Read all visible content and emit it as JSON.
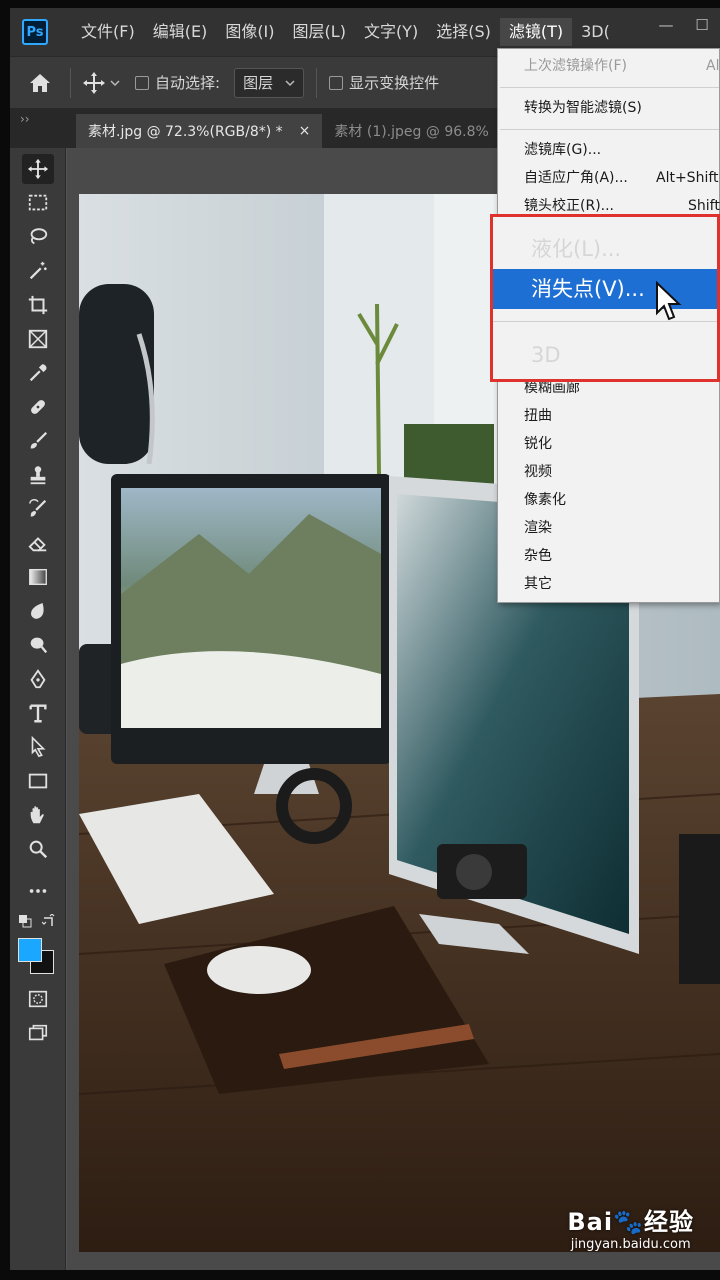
{
  "app": {
    "logo": "Ps"
  },
  "menubar": {
    "items": [
      "文件(F)",
      "编辑(E)",
      "图像(I)",
      "图层(L)",
      "文字(Y)",
      "选择(S)",
      "滤镜(T)",
      "3D("
    ],
    "active_index": 6
  },
  "window_controls": {
    "minimize": "—",
    "maximize": "☐"
  },
  "options": {
    "auto_select_label": "自动选择:",
    "layer_select_value": "图层",
    "show_transform_label": "显示变换控件"
  },
  "tabs": [
    {
      "label": "素材.jpg @ 72.3%(RGB/8*) *",
      "close": "×"
    },
    {
      "label": "素材 (1).jpeg @ 96.8%"
    }
  ],
  "filter_menu": {
    "last_filter": {
      "label": "上次滤镜操作(F)",
      "shortcut": "Alt"
    },
    "convert_smart": "转换为智能滤镜(S)",
    "filter_gallery": "滤镜库(G)...",
    "adaptive_wide": {
      "label": "自适应广角(A)...",
      "shortcut": "Alt+Shift"
    },
    "lens_correction": {
      "label": "镜头校正(R)...",
      "shortcut": "Shift"
    },
    "liquify": "液化(L)...",
    "vanishing_point": "消失点(V)...",
    "three_d": "3D",
    "submenus": [
      "模糊画廊",
      "扭曲",
      "锐化",
      "视频",
      "像素化",
      "渲染",
      "杂色",
      "其它"
    ]
  },
  "colors": {
    "foreground": "#1aa7ff",
    "background": "#111111",
    "highlight": "#1e6fd4",
    "callout": "#e0322c"
  },
  "icons": {
    "tools": [
      "move-icon",
      "marquee-icon",
      "lasso-icon",
      "magic-wand-icon",
      "crop-icon",
      "frame-icon",
      "eyedropper-icon",
      "healing-icon",
      "brush-icon",
      "stamp-icon",
      "history-brush-icon",
      "eraser-icon",
      "gradient-icon",
      "blur-icon",
      "dodge-icon",
      "pen-icon",
      "type-icon",
      "path-select-icon",
      "rectangle-icon",
      "hand-icon",
      "zoom-icon",
      "more-icon"
    ]
  },
  "watermark": {
    "title": "Bai",
    "brand": "经验",
    "url": "jingyan.baidu.com"
  }
}
